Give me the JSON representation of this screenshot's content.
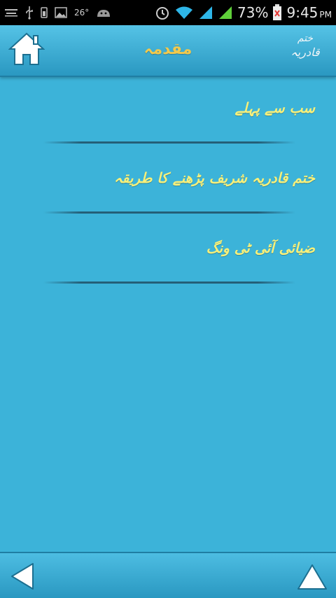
{
  "status_bar": {
    "temperature": "26°",
    "battery_percent": "73%",
    "time": "9:45",
    "ampm": "PM"
  },
  "header": {
    "title": "مقدمہ",
    "logo_line1": "ختم",
    "logo_line2": "قادریہ"
  },
  "list": {
    "items": [
      {
        "label": "سب سے پہلے"
      },
      {
        "label": "ختم قادریہ شریف پڑھنے کا طریقہ"
      },
      {
        "label": "ضیائی آئی ٹی ونگ"
      }
    ]
  },
  "icons": {
    "home": "home-icon",
    "back": "left-arrow-icon",
    "up": "up-arrow-icon"
  },
  "colors": {
    "background": "#3cb3d9",
    "title_text": "#f2c94c",
    "item_text": "#f7f07a",
    "divider": "#245f78"
  }
}
